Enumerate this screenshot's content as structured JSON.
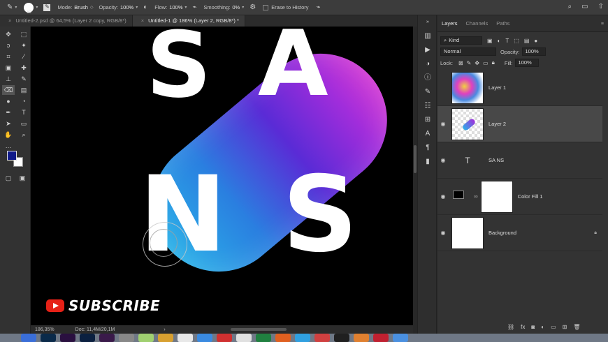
{
  "options_bar": {
    "brush_size": "60",
    "mode_label": "Mode:",
    "mode_value": "Brush",
    "opacity_label": "Opacity:",
    "opacity_value": "100%",
    "flow_label": "Flow:",
    "flow_value": "100%",
    "smoothing_label": "Smoothing:",
    "smoothing_value": "0%",
    "erase_history_label": "Erase to History"
  },
  "tabs": [
    {
      "label": "Untitled-2.psd @ 64,5% (Layer 2 copy, RGB/8*)",
      "active": false
    },
    {
      "label": "Untitled-1 @ 186% (Layer 2, RGB/8*) *",
      "active": true
    }
  ],
  "canvas": {
    "letters": [
      "S",
      "A",
      "N",
      "S"
    ],
    "subscribe_text": "SUBSCRIBE"
  },
  "status_bar": {
    "zoom": "186,35%",
    "doc_info": "Doc: 11,4M/20,1M",
    "arrow": "›"
  },
  "layers_panel": {
    "tabs": [
      "Layers",
      "Channels",
      "Paths"
    ],
    "filter_kind": "Kind",
    "blend_mode": "Normal",
    "opacity_label": "Opacity:",
    "opacity_value": "100%",
    "lock_label": "Lock:",
    "fill_label": "Fill:",
    "fill_value": "100%",
    "layers": [
      {
        "name": "Layer 1",
        "selected": false
      },
      {
        "name": "Layer 2",
        "selected": true
      },
      {
        "name": "SA NS",
        "selected": false
      },
      {
        "name": "Color Fill 1",
        "selected": false
      },
      {
        "name": "Background",
        "selected": false
      }
    ],
    "footer_fx": "fx"
  },
  "colors": {
    "foreground": "#101a8a",
    "background": "#ffffff",
    "youtube_red": "#e62117"
  }
}
